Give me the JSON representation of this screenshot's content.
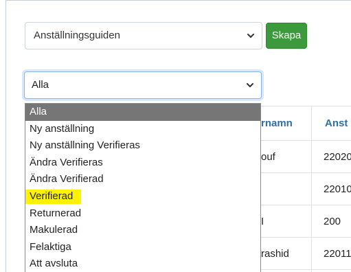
{
  "guide_select": {
    "value": "Anställningsguiden"
  },
  "create_button": {
    "label": "Skapa",
    "color": "#3c9a3c"
  },
  "status_select": {
    "value": "Alla",
    "options": [
      {
        "label": "Alla",
        "selected": true
      },
      {
        "label": "Ny anställning"
      },
      {
        "label": "Ny anställning Verifieras"
      },
      {
        "label": "Ändra Verifieras"
      },
      {
        "label": "Ändra Verifierad"
      },
      {
        "label": "Verifierad",
        "highlighted": true
      },
      {
        "label": "Returnerad"
      },
      {
        "label": "Makulerad"
      },
      {
        "label": "Felaktiga"
      },
      {
        "label": "Att avsluta"
      }
    ]
  },
  "table": {
    "headers": [
      "rnamn",
      "Anst"
    ],
    "rows": [
      [
        "ouf",
        "22020"
      ],
      [
        "",
        "22010"
      ],
      [
        "I",
        "200"
      ],
      [
        "rashid",
        "22011"
      ]
    ]
  },
  "colors": {
    "header_link": "#2f6fa8",
    "highlight": "#fff200",
    "selected_option_bg": "#767676"
  }
}
